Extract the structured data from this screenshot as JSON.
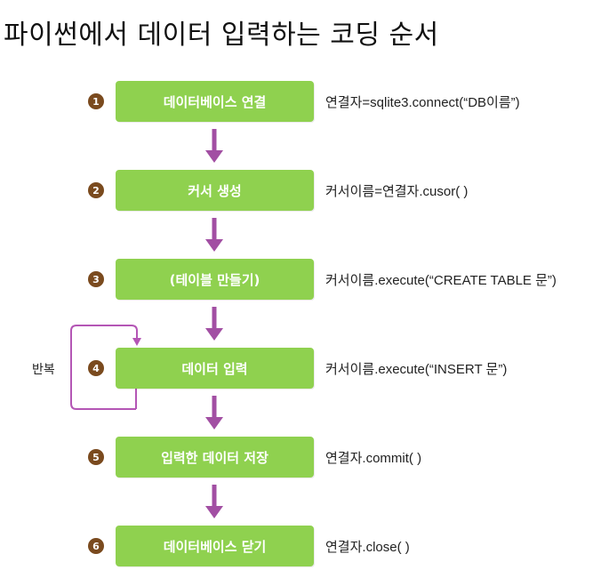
{
  "title": "파이썬에서 데이터 입력하는 코딩 순서",
  "repeat_label": "반복",
  "colors": {
    "box": "#8fd14f",
    "arrow": "#a24fa3",
    "loop": "#b456b5",
    "number": "#7a4a1e"
  },
  "steps": [
    {
      "number": "1",
      "label": "데이터베이스 연결",
      "code": "연결자=sqlite3.connect(“DB이름”)"
    },
    {
      "number": "2",
      "label": "커서 생성",
      "code": "커서이름=연결자.cusor( )"
    },
    {
      "number": "3",
      "label": "(테이블 만들기)",
      "code": "커서이름.execute(“CREATE TABLE 문”)"
    },
    {
      "number": "4",
      "label": "데이터 입력",
      "code": "커서이름.execute(“INSERT 문”)"
    },
    {
      "number": "5",
      "label": "입력한 데이터 저장",
      "code": "연결자.commit( )"
    },
    {
      "number": "6",
      "label": "데이터베이스 닫기",
      "code": "연결자.close( )"
    }
  ]
}
